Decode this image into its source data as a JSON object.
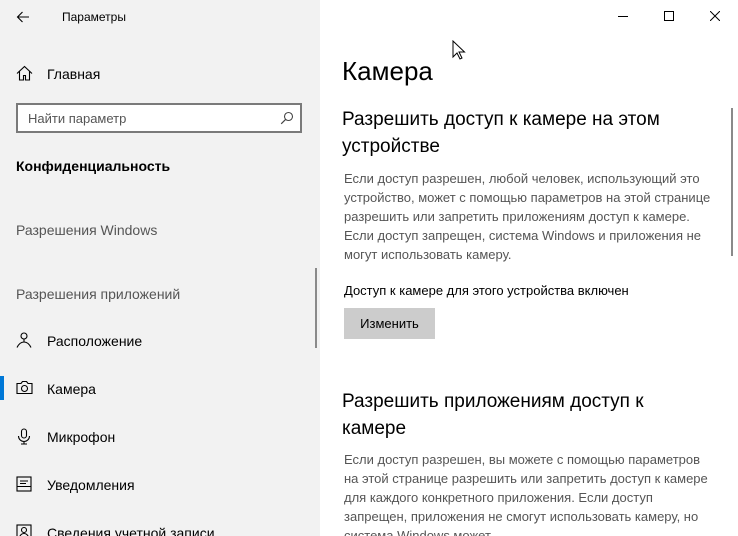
{
  "window": {
    "title": "Параметры",
    "controls": {
      "minimize": "minimize-icon",
      "maximize": "maximize-icon",
      "close": "close-icon"
    }
  },
  "sidebar": {
    "back_icon": "back-arrow-icon",
    "home": {
      "label": "Главная",
      "icon": "home-icon"
    },
    "search": {
      "placeholder": "Найти параметр",
      "value": "",
      "icon": "search-icon"
    },
    "section_title": "Конфиденциальность",
    "windows_permissions_label": "Разрешения Windows",
    "app_permissions_label": "Разрешения приложений",
    "items": [
      {
        "label": "Расположение",
        "icon": "location-icon"
      },
      {
        "label": "Камера",
        "icon": "camera-icon",
        "active": true
      },
      {
        "label": "Микрофон",
        "icon": "microphone-icon"
      },
      {
        "label": "Уведомления",
        "icon": "notifications-icon"
      },
      {
        "label": "Сведения учетной записи",
        "icon": "account-info-icon"
      }
    ]
  },
  "main": {
    "title": "Камера",
    "device_section": {
      "heading": "Разрешить доступ к камере на этом устройстве",
      "description": "Если доступ разрешен, любой человек, использующий это устройство, может с помощью параметров на этой странице разрешить или запретить приложениям доступ к камере. Если доступ запрещен, система Windows и приложения не могут использовать камеру.",
      "status": "Доступ к камере для этого устройства включен",
      "change_button": "Изменить"
    },
    "apps_section": {
      "heading": "Разрешить приложениям доступ к камере",
      "description": "Если доступ разрешен, вы можете с помощью параметров на этой странице разрешить или запретить доступ к камере для каждого конкретного приложения. Если доступ запрещен, приложения не смогут использовать камеру, но система Windows может"
    }
  },
  "colors": {
    "accent": "#0078d7",
    "sidebar_bg": "#f2f2f2",
    "button_bg": "#cccccc"
  }
}
